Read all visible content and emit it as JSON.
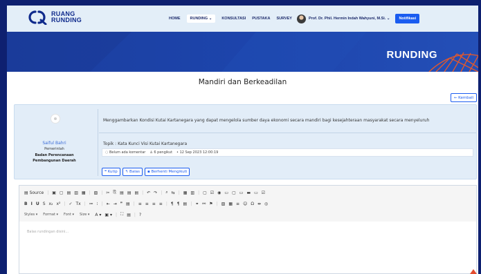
{
  "header": {
    "logo": {
      "line1": "RUANG",
      "line2": "RUNDING"
    },
    "nav": [
      {
        "label": "HOME"
      },
      {
        "label": "RUNDING ⌄",
        "active": true
      },
      {
        "label": "KONSULTASI"
      },
      {
        "label": "PUSTAKA"
      },
      {
        "label": "SURVEY"
      }
    ],
    "user_name": "Prof. Dr. Phil. Hermin Indah Wahyuni, M.Si. ⌄",
    "notif_label": "Notifikasi",
    "colors": {
      "header_bg": "#e3eef8",
      "brand": "#0f2a8c",
      "accent": "#1a5cf0"
    }
  },
  "banner": {
    "title": "RUNDING"
  },
  "page": {
    "title": "Mandiri dan Berkeadilan",
    "back_label": "← Kembali"
  },
  "post": {
    "author": {
      "name": "Saiful Bahri",
      "role": "Pemerintah",
      "org_line1": "Badan Perencanaan",
      "org_line2": "Pembangunan Daerah"
    },
    "body": "Menggambarkan Kondisi Kutai Kartanegara yang dapat mengelola sumber daya ekonomi secara mandiri bagi kesejahteraan masyarakat secara menyeluruh",
    "topic": "Topik : Kata Kunci Visi Kutai Kartanegara",
    "meta": {
      "comments": "◌ Belum ada komentar",
      "followers": "♙ 6 pengikut",
      "date": "• 12 Sep 2023 12:00:19"
    },
    "actions": {
      "quote": "❝ Kutip",
      "reply": "↰ Balas",
      "unfollow": "▪ Berhenti Mengikuti"
    }
  },
  "editor": {
    "row1": [
      "▤ Source",
      "|",
      "▣",
      "▢",
      "▤",
      "▥",
      "▦",
      "|",
      "▧",
      "|",
      "✂",
      "⎘",
      "▤",
      "▤",
      "▤",
      "|",
      "↶",
      "↷",
      "|",
      "⌕",
      "⇆",
      "|",
      "▦",
      "▥",
      "|",
      "▢",
      "☑",
      "◉",
      "▭",
      "▢",
      "▭",
      "▬",
      "▭",
      "☑"
    ],
    "row2": [
      "B",
      "I",
      "U",
      "S",
      "x₂",
      "x²",
      "|",
      "✓",
      "Tx",
      "|",
      "≔",
      "⁝",
      "|",
      "⇤",
      "⇥",
      "❞",
      "▤",
      "|",
      "≡",
      "≡",
      "≡",
      "≡",
      "|",
      "¶",
      "¶",
      "▤",
      "|",
      "⚭",
      "⚯",
      "⚑",
      "|",
      "▨",
      "▦",
      "≡",
      "☺",
      "Ω",
      "⇹",
      "◎"
    ],
    "styles_label": "Styles",
    "format_label": "Format",
    "font_label": "Font",
    "size_label": "Size",
    "row3_tail": [
      "A ▾",
      "▣ ▾",
      "|",
      "⛶",
      "▤",
      "|",
      "?"
    ],
    "placeholder": "Balas rundingan disini..."
  }
}
